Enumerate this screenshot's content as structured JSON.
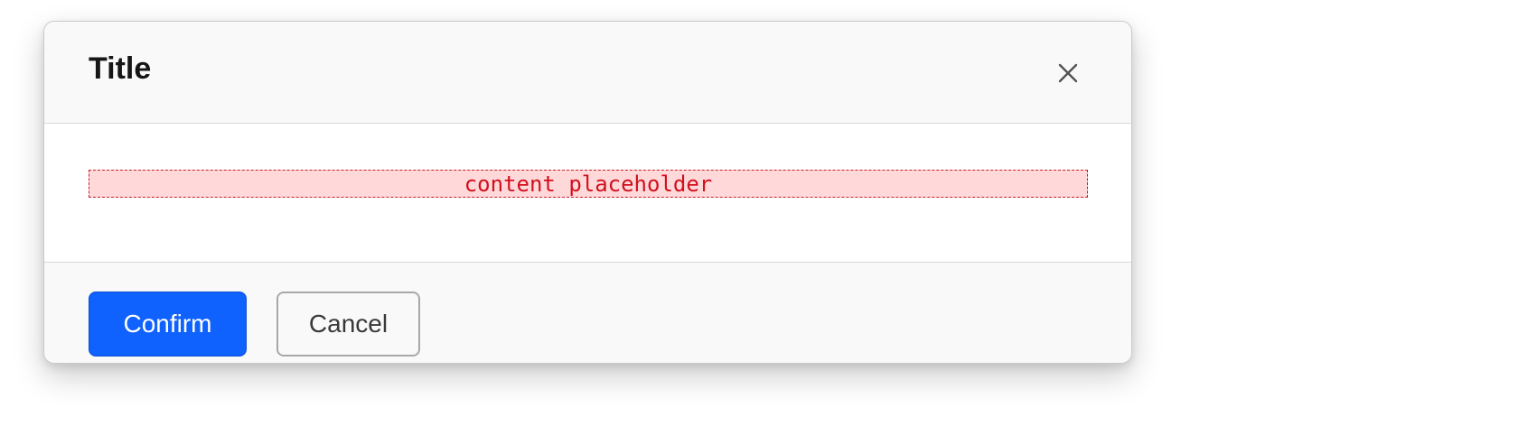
{
  "dialog": {
    "title": "Title",
    "close_icon": "close-icon",
    "content_placeholder": "content placeholder",
    "confirm_label": "Confirm",
    "cancel_label": "Cancel"
  },
  "colors": {
    "primary": "#0f62fe",
    "placeholder_bg": "#ffd9da",
    "placeholder_border": "#c81e2a",
    "placeholder_text": "#d0101e"
  }
}
